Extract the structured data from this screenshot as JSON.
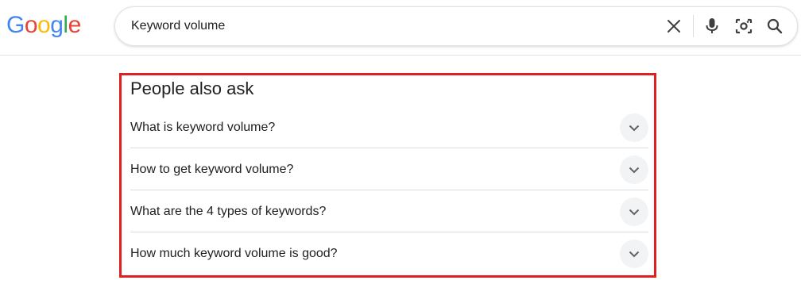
{
  "header": {
    "logo": {
      "letters": [
        "G",
        "o",
        "o",
        "g",
        "l",
        "e"
      ],
      "colors": [
        "#4285F4",
        "#EA4335",
        "#FBBC05",
        "#4285F4",
        "#34A853",
        "#EA4335"
      ]
    },
    "search": {
      "value": "Keyword volume",
      "icons": [
        "close-icon",
        "microphone-icon",
        "camera-lens-icon",
        "search-icon"
      ]
    }
  },
  "people_also_ask": {
    "title": "People also ask",
    "questions": [
      "What is keyword volume?",
      "How to get keyword volume?",
      "What are the 4 types of keywords?",
      "How much keyword volume is good?"
    ],
    "highlight_color": "#e02020"
  }
}
